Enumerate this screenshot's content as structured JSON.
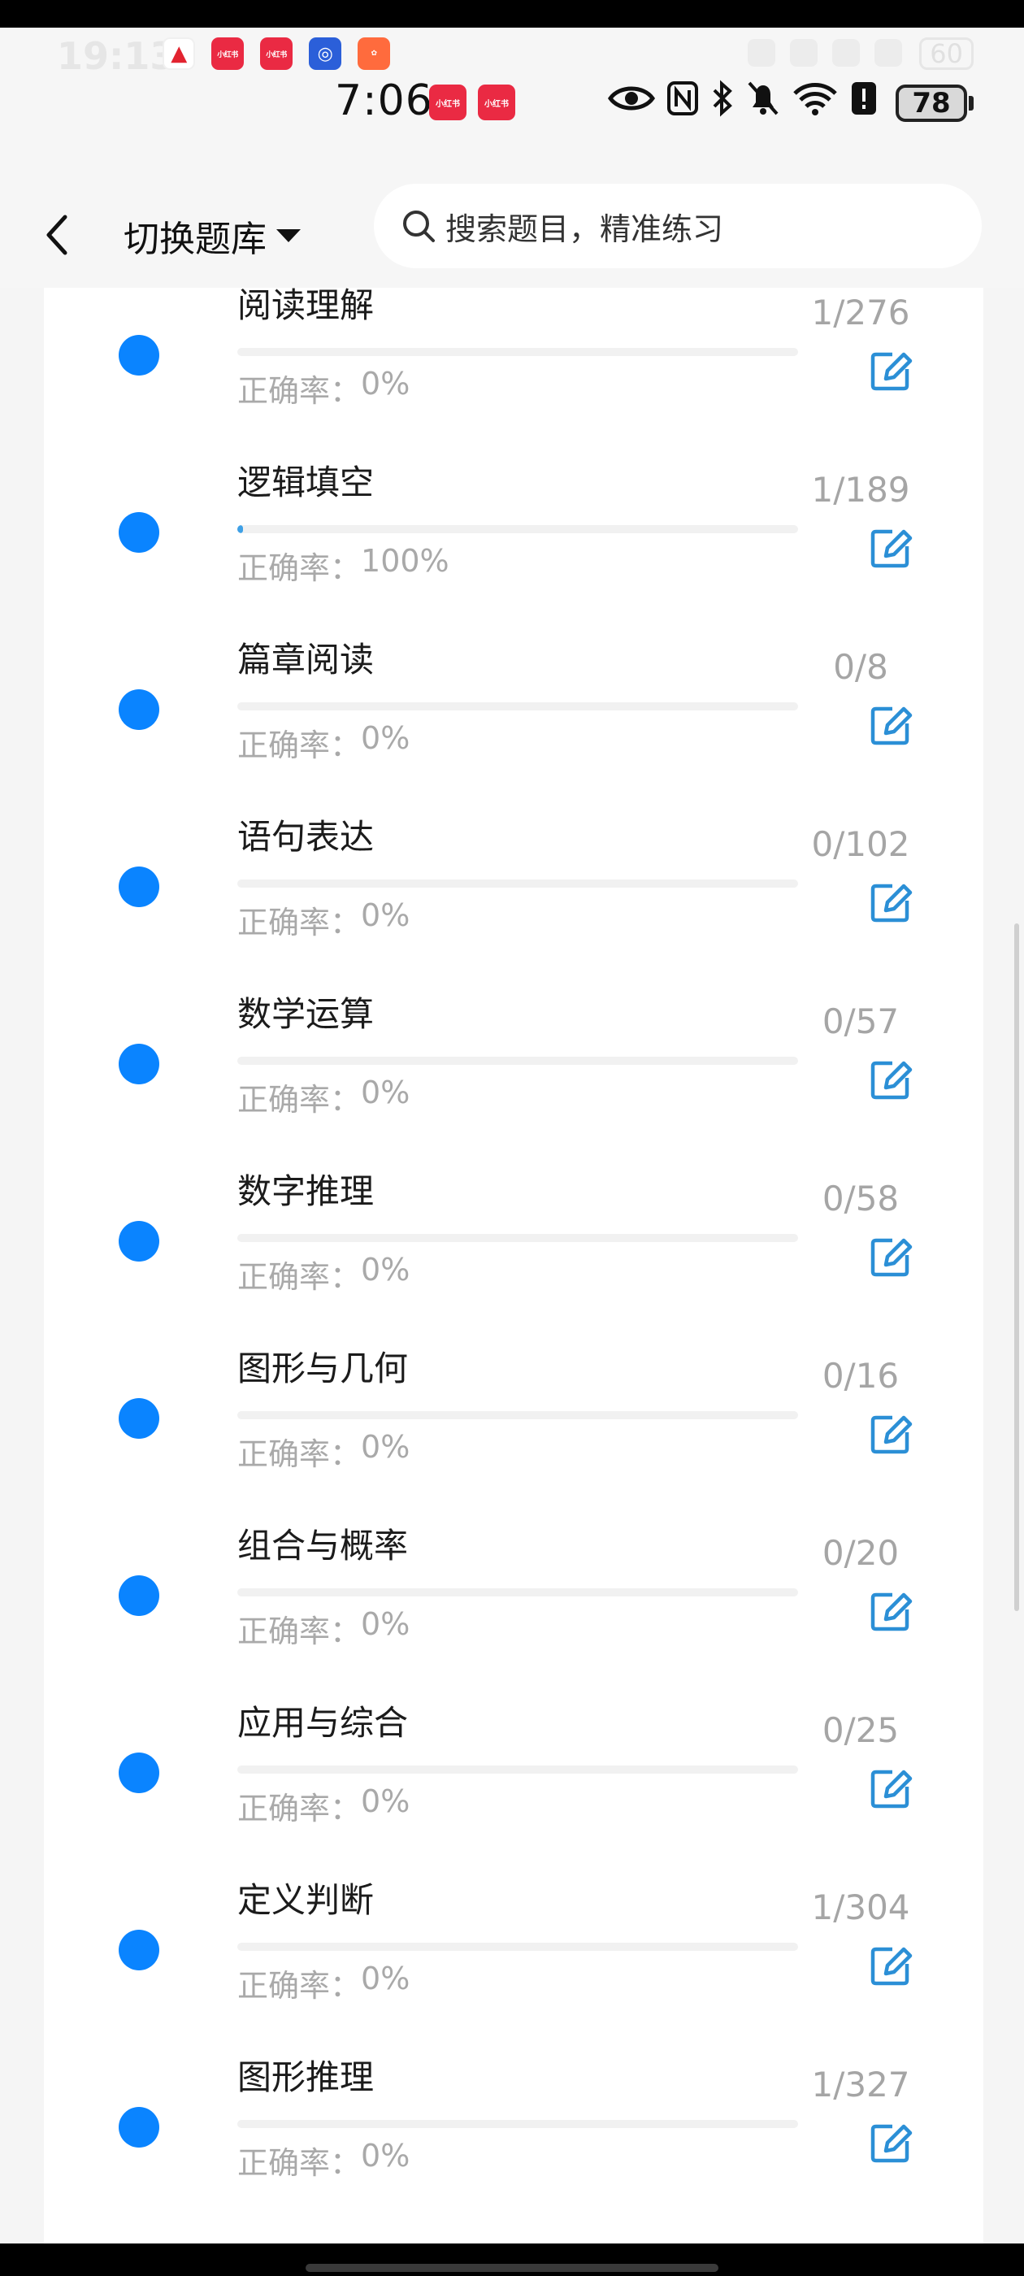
{
  "status_bar": {
    "time": "7:06",
    "ghost_time": "19:13",
    "ghost_battery": "60",
    "battery_level": "78",
    "badge_text": "小红书"
  },
  "header": {
    "bank_title": "切换题库",
    "search_placeholder": "搜索题目，精准练习"
  },
  "accuracy_label": "正确率：",
  "items": [
    {
      "title": "阅读理解",
      "accuracy": "0%",
      "count": "1/276",
      "progress": 0
    },
    {
      "title": "逻辑填空",
      "accuracy": "100%",
      "count": "1/189",
      "progress": 0.01
    },
    {
      "title": "篇章阅读",
      "accuracy": "0%",
      "count": "0/8",
      "progress": 0
    },
    {
      "title": "语句表达",
      "accuracy": "0%",
      "count": "0/102",
      "progress": 0
    },
    {
      "title": "数学运算",
      "accuracy": "0%",
      "count": "0/57",
      "progress": 0
    },
    {
      "title": "数字推理",
      "accuracy": "0%",
      "count": "0/58",
      "progress": 0
    },
    {
      "title": "图形与几何",
      "accuracy": "0%",
      "count": "0/16",
      "progress": 0
    },
    {
      "title": "组合与概率",
      "accuracy": "0%",
      "count": "0/20",
      "progress": 0
    },
    {
      "title": "应用与综合",
      "accuracy": "0%",
      "count": "0/25",
      "progress": 0
    },
    {
      "title": "定义判断",
      "accuracy": "0%",
      "count": "1/304",
      "progress": 0
    },
    {
      "title": "图形推理",
      "accuracy": "0%",
      "count": "1/327",
      "progress": 0
    }
  ],
  "colors": {
    "dot": "#0a84ff",
    "edit_icon": "#2b8fd6",
    "progress": "#3ea0e6"
  },
  "icons": {
    "back": "chevron-left-icon",
    "dropdown": "caret-down-icon",
    "search": "search-icon",
    "edit": "edit-icon"
  }
}
